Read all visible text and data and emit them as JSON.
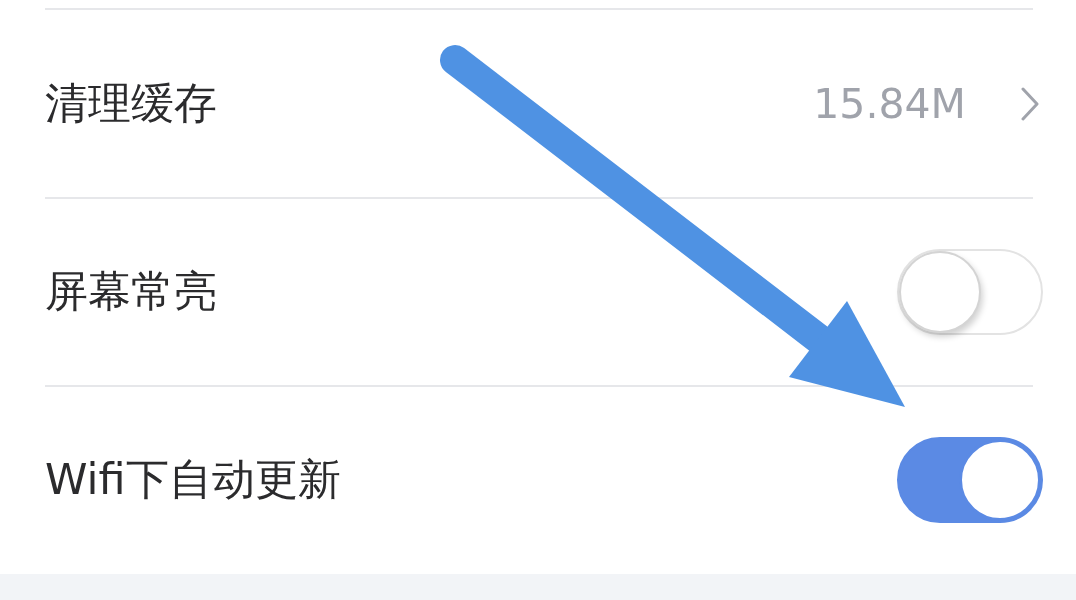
{
  "settings": [
    {
      "kind": "value",
      "label": "清理缓存",
      "value": "15.84M"
    },
    {
      "kind": "toggle",
      "label": "屏幕常亮",
      "on": false
    },
    {
      "kind": "toggle",
      "label": "Wifi下自动更新",
      "on": true
    }
  ]
}
